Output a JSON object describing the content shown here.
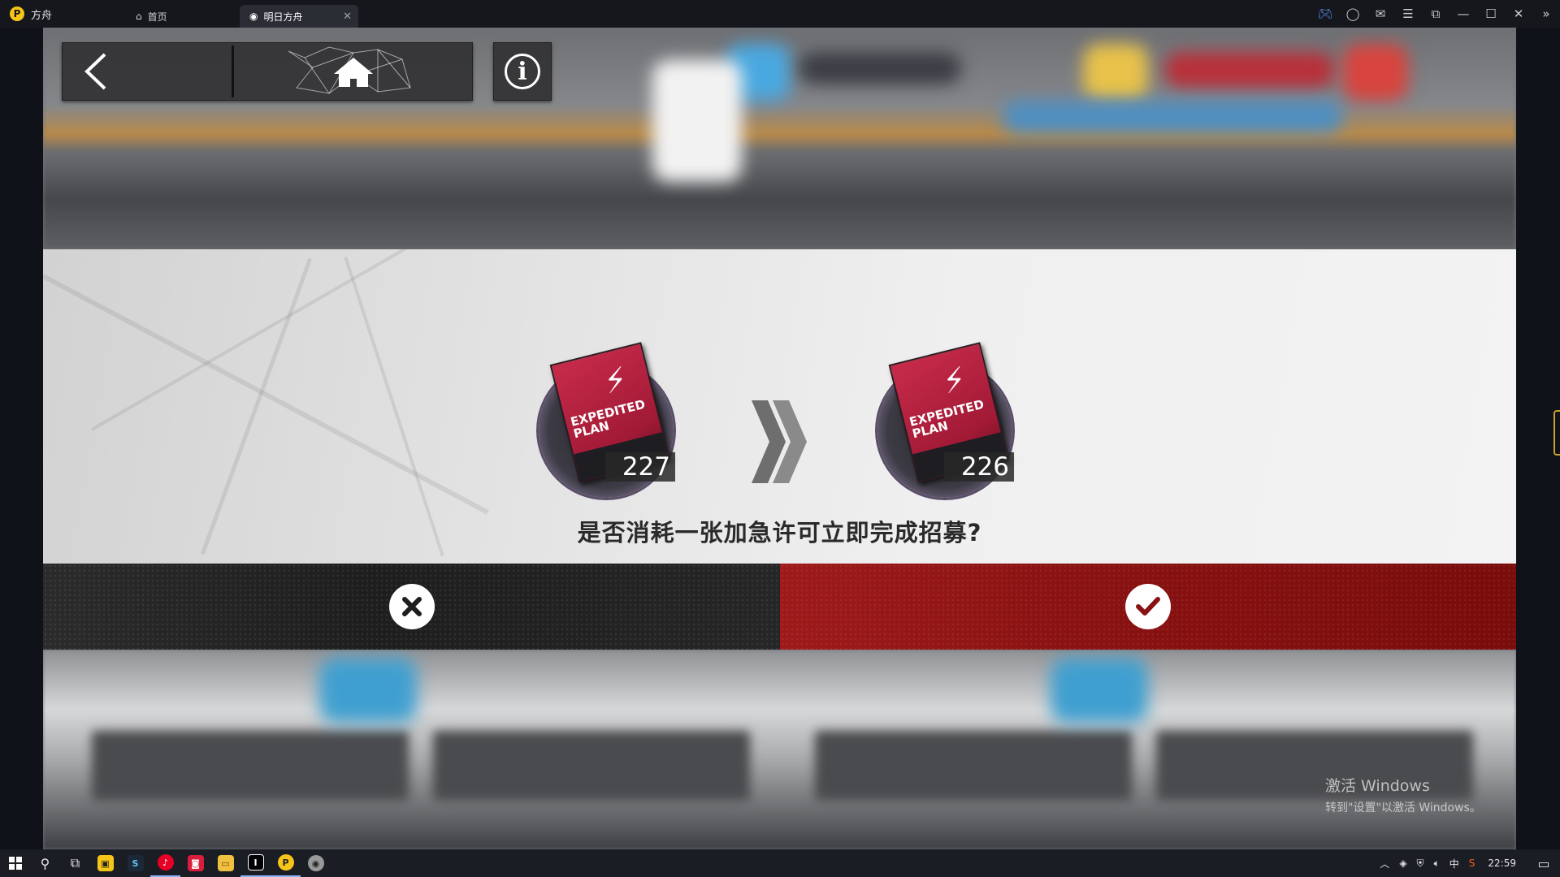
{
  "titlebar": {
    "app_name": "方舟",
    "tabs": [
      {
        "label": "首页",
        "icon": "home-icon"
      },
      {
        "label": "明日方舟",
        "icon": "arknights-icon",
        "active": true
      }
    ],
    "controls": [
      "gamepad-icon",
      "account-icon",
      "mail-icon",
      "menu-icon",
      "restore-window-icon",
      "minimize-icon",
      "maximize-icon",
      "close-icon",
      "expand-sidebar-icon"
    ]
  },
  "game": {
    "nav": {
      "back_icon": "back-arrow-icon",
      "home_icon": "home-icon",
      "info_icon": "info-icon"
    },
    "dialog": {
      "item_before_count": "227",
      "item_after_count": "226",
      "item_label_line1": "EXPEDITED",
      "item_label_line2": "PLAN",
      "question": "是否消耗一张加急许可立即完成招募?",
      "cancel_icon": "close-icon",
      "confirm_icon": "checkmark-icon",
      "confirm_color": "#8a1212",
      "cancel_color": "#1e1e1e"
    }
  },
  "watermark": {
    "title": "激活 Windows",
    "subtitle": "转到\"设置\"以激活 Windows。"
  },
  "taskbar": {
    "apps": [
      "windows-start-icon",
      "search-icon",
      "task-view-icon",
      "app-yellow-icon",
      "steam-icon",
      "netease-music-icon",
      "app-red-icon",
      "file-explorer-icon",
      "app-ide-icon",
      "emulator-icon",
      "arknights-icon"
    ],
    "tray": {
      "input_method": "中",
      "time": "22:59"
    }
  }
}
